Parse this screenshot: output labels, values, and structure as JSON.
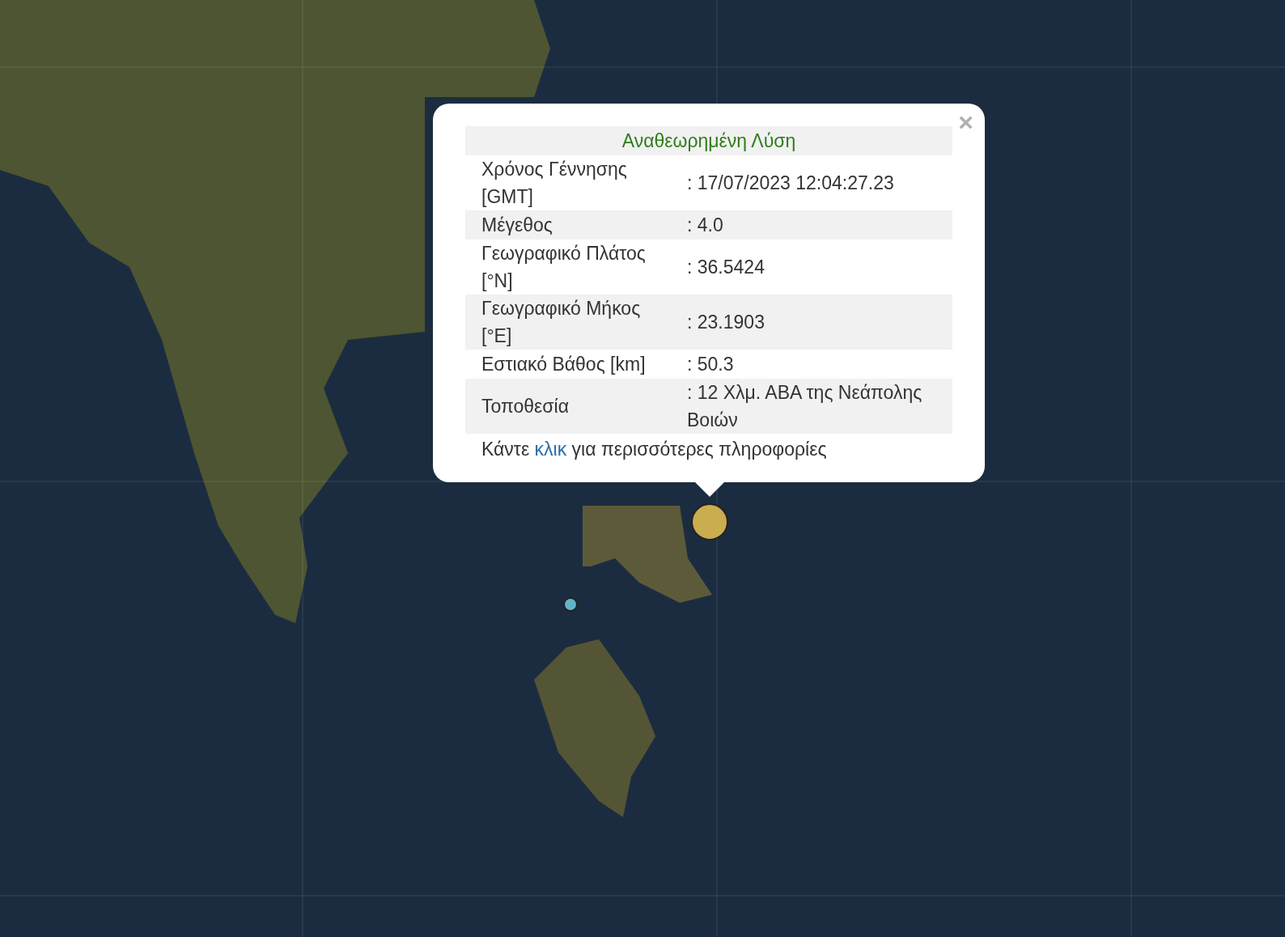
{
  "map": {
    "markers": [
      {
        "color": "#c9ad4f"
      },
      {
        "color": "#5fb6c9"
      }
    ]
  },
  "popup": {
    "close": "×",
    "title": "Αναθεωρημένη Λύση",
    "rows": [
      {
        "label": "Χρόνος Γέννησης [GMT]",
        "value": ": 17/07/2023 12:04:27.23"
      },
      {
        "label": "Μέγεθος",
        "value": ": 4.0"
      },
      {
        "label": "Γεωγραφικό Πλάτος [°N]",
        "value": ": 36.5424"
      },
      {
        "label": "Γεωγραφικό Μήκος [°E]",
        "value": ": 23.1903"
      },
      {
        "label": "Εστιακό Βάθος [km]",
        "value": ": 50.3"
      },
      {
        "label": "Τοποθεσία",
        "value": ": 12 Χλμ. ΑΒΑ της Νεάπολης Βοιών"
      }
    ],
    "footer": {
      "before": "Κάντε",
      "link": "κλικ",
      "after": "για περισσότερες πληροφορίες"
    }
  }
}
